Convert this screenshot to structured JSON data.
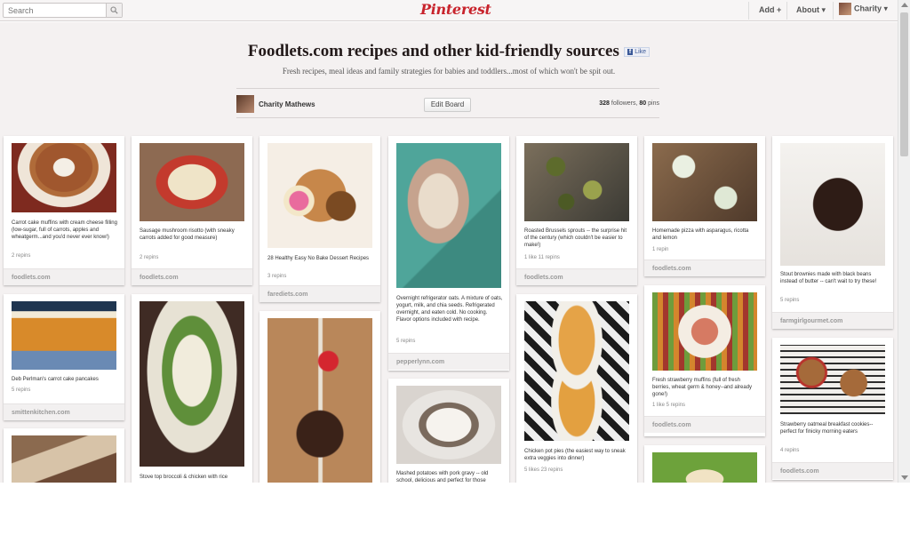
{
  "header": {
    "search_placeholder": "Search",
    "logo": "Pinterest",
    "add": "Add +",
    "about": "About ▾",
    "user": "Charity ▾"
  },
  "board": {
    "title": "Foodlets.com recipes and other kid-friendly sources",
    "fb_like": "Like",
    "description": "Fresh recipes, meal ideas and family strategies for babies and toddlers...most of which won't be spit out.",
    "owner": "Charity Mathews",
    "edit_button": "Edit Board",
    "followers": "328",
    "followers_label": " followers, ",
    "pins": "80",
    "pins_label": " pins"
  },
  "pins": [
    {
      "desc": "Carrot cake muffins with cream cheese filling (low-sugar, full of carrots, apples and wheatgerm...and you'd never ever know!)",
      "stats": "2 repins",
      "source": "foodlets.com"
    },
    {
      "desc": "Deb Perlman's carrot cake pancakes",
      "stats": "5 repins",
      "source": "smittenkitchen.com"
    },
    {
      "desc": "Sausage mushroom risotto (with sneaky carrots added for good measure)",
      "stats": "2 repins",
      "source": "foodlets.com"
    },
    {
      "desc": "Stove top broccoli & chicken with rice",
      "stats": "",
      "source": ""
    },
    {
      "desc": "28 Healthy Easy No Bake Dessert Recipes",
      "stats": "3 repins",
      "source": "farediets.com"
    },
    {
      "desc": "Overnight refrigerator oats. A mixture of oats, yogurt, milk, and chia seeds. Refrigerated overnight, and eaten cold. No cooking. Flavor options included with recipe.",
      "stats": "5 repins",
      "source": "pepperlynn.com"
    },
    {
      "desc": "Mashed potatoes with pork gravy -- old school, delicious and perfect for those",
      "stats": "",
      "source": ""
    },
    {
      "desc": "Roasted Brussels sprouts -- the surprise hit of the century (which couldn't be easier to make!)",
      "stats": "1 like  11 repins",
      "source": "foodlets.com"
    },
    {
      "desc": "Chicken pot pies (the easiest way to sneak extra veggies into dinner)",
      "stats": "5 likes  23 repins",
      "source": ""
    },
    {
      "desc": "Homemade pizza with asparagus, ricotta and lemon",
      "stats": "1 repin",
      "source": "foodlets.com"
    },
    {
      "desc": "Fresh strawberry muffins (full of fresh berries, wheat germ & honey--and already gone!)",
      "stats": "1 like  5 repins",
      "source": "foodlets.com"
    },
    {
      "desc": "Stout brownies made with black beans instead of butter -- can't wait to try these!",
      "stats": "5 repins",
      "source": "farmgirlgourmet.com"
    },
    {
      "desc": "Strawberry oatmeal breakfast cookies--perfect for finicky morning eaters",
      "stats": "4 repins",
      "source": "foodlets.com"
    }
  ],
  "colors": {
    "brand": "#c8232c",
    "background": "#f4f1f1"
  }
}
